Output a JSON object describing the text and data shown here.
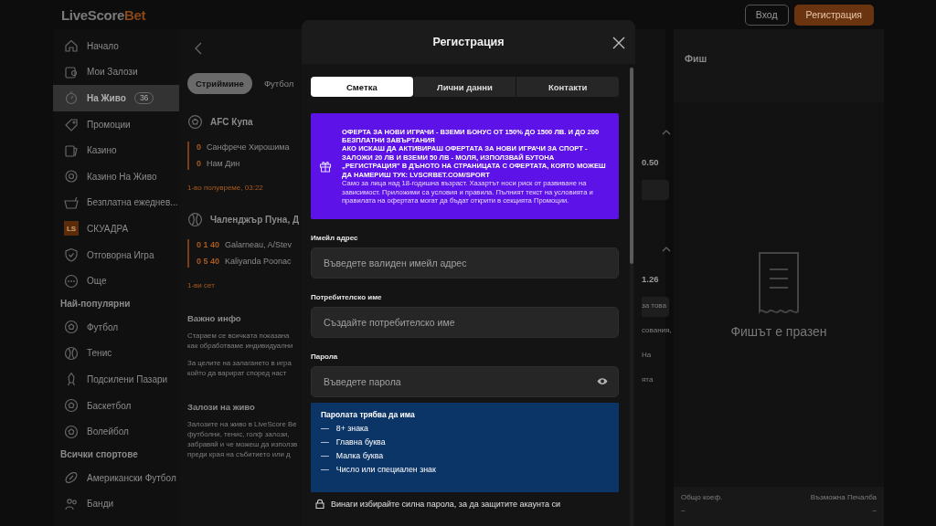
{
  "header": {
    "logo": {
      "main": "LiveScore",
      "accent": "Bet"
    },
    "buttons": [
      {
        "label": "Вход",
        "kind": "outline"
      },
      {
        "label": "Регистрация",
        "kind": "primary"
      }
    ]
  },
  "sidebar": {
    "items": [
      {
        "label": "Начало",
        "kind": "home",
        "selected": false
      },
      {
        "label": "Мои Залози",
        "kind": "ticket",
        "selected": false
      },
      {
        "label": "На Живо",
        "kind": "stopwatch",
        "selected": true,
        "count": "36"
      },
      {
        "label": "Промоции",
        "kind": "tag",
        "selected": false
      },
      {
        "label": "Казино",
        "kind": "cards",
        "selected": false
      },
      {
        "label": "Казино На Живо",
        "kind": "chip",
        "selected": false
      },
      {
        "label": "Безплатна ежеднев...",
        "kind": "basket",
        "selected": false
      },
      {
        "label": "СКУАДРА",
        "kind": "badge",
        "badge_text": "LS",
        "selected": false
      },
      {
        "label": "Отговорна Игра",
        "kind": "shield",
        "selected": false
      },
      {
        "label": "Още",
        "kind": "dots",
        "selected": false
      }
    ],
    "sections": [
      {
        "title": "Най-популярни",
        "items": [
          {
            "label": "Футбол",
            "kind": "ball",
            "selected": false
          },
          {
            "label": "Тенис",
            "kind": "tennis",
            "selected": false
          },
          {
            "label": "Подсилени Пазари",
            "kind": "rocket",
            "selected": false
          },
          {
            "label": "Баскетбол",
            "kind": "ball",
            "selected": false
          },
          {
            "label": "Волейбол",
            "kind": "ball",
            "selected": false
          }
        ]
      },
      {
        "title": "Всички спортове",
        "items": [
          {
            "label": "Американски Футбол",
            "kind": "oval",
            "selected": false
          },
          {
            "label": "Банди",
            "kind": "people",
            "selected": false
          }
        ]
      }
    ]
  },
  "main": {
    "filters": [
      {
        "label": "Стриймине",
        "selected": true
      },
      {
        "label": "Футбол",
        "selected": false
      }
    ],
    "events": [
      {
        "competition": "AFC Купа",
        "kind": "ball",
        "odds": "0.50",
        "rows": [
          {
            "score": "0",
            "team": "Санфрече Хирошима"
          },
          {
            "score": "0",
            "team": "Нам Дин"
          }
        ],
        "status": "1-во полувреме, 03:22"
      },
      {
        "competition": "Чаленджър Пуна, Д",
        "kind": "tennis",
        "odds": "1.26",
        "rows": [
          {
            "score": "0 1 40",
            "team": "Galarneau, A/Stev"
          },
          {
            "score": "0 5 40",
            "team": "Kaliyanda Poonac"
          }
        ],
        "status": "1-ви сет"
      }
    ],
    "info": [
      {
        "title": "Важно инфо",
        "paragraphs": [
          {
            "lines": [
              "Стараем се всичката показана",
              "как обработваме индивидуални"
            ]
          },
          {
            "lines": [
              "За целите на залагането в игра",
              "който да варират според наст"
            ]
          }
        ]
      },
      {
        "title": "Залози на живо",
        "paragraphs": [
          {
            "lines": [
              "Залозите на живо в LiveScore Be",
              "футболни, тенис, голф залози,",
              "забравяй и че можеш да използв",
              "преди края на събитието или д"
            ]
          }
        ]
      }
    ],
    "right_fragments": [
      "за това",
      "сования,",
      "На",
      "ята"
    ]
  },
  "betslip": {
    "title": "Фиш",
    "empty_text": "Фишът е празен",
    "totals": [
      {
        "label": "Общо коеф.",
        "value": "–"
      },
      {
        "label": "Възможна Печалба",
        "value": "–"
      }
    ]
  },
  "modal": {
    "title": "Регистрация",
    "tabs": [
      {
        "label": "Сметка",
        "selected": true
      },
      {
        "label": "Лични данни",
        "selected": false
      },
      {
        "label": "Контакти",
        "selected": false
      }
    ],
    "promo": {
      "headline": "ОФЕРТА ЗА НОВИ ИГРАЧИ - ВЗЕМИ БОНУС ОТ 150% ДО 1500 ЛВ. И ДО 200 БЕЗПЛАТНИ ЗАВЪРТАНИЯ",
      "body": "АКО ИСКАШ ДА АКТИВИРАШ ОФЕРТАТА ЗА НОВИ ИГРАЧИ ЗА СПОРТ - ЗАЛОЖИ 20 ЛВ И ВЗЕМИ 50 ЛВ - МОЛЯ, ИЗПОЛЗВАЙ БУТОНА „РЕГИСТРАЦИЯ\" В ДЪНОТО НА СТРАНИЦАТА С ОФЕРТАТА, КОЯТО МОЖЕШ ДА НАМЕРИШ ТУК: LVSCRBET.COM/SPORT",
      "disclaimer": "Само за лица над 18-годишна възраст. Хазартът носи риск от развиване на зависимост. Приложими са условия и правила. Пълният текст на условията и правилата на офертата могат да бъдат открити в секцията Промоции."
    },
    "fields": [
      {
        "label": "Имейл адрес",
        "placeholder": "Въведете валиден имейл адрес",
        "kind": "text"
      },
      {
        "label": "Потребителско име",
        "placeholder": "Създайте потребителско име",
        "kind": "text"
      },
      {
        "label": "Парола",
        "placeholder": "Въведете парола",
        "kind": "password"
      }
    ],
    "password_rules": {
      "title": "Паролата трябва да има",
      "items": [
        {
          "marker": "—",
          "text": "8+ знака"
        },
        {
          "marker": "—",
          "text": "Главна буква"
        },
        {
          "marker": "—",
          "text": "Малка буква"
        },
        {
          "marker": "—",
          "text": "Число или специален знак"
        }
      ]
    },
    "tip": "Винаги избирайте силна парола, за да защитите акаунта си"
  }
}
